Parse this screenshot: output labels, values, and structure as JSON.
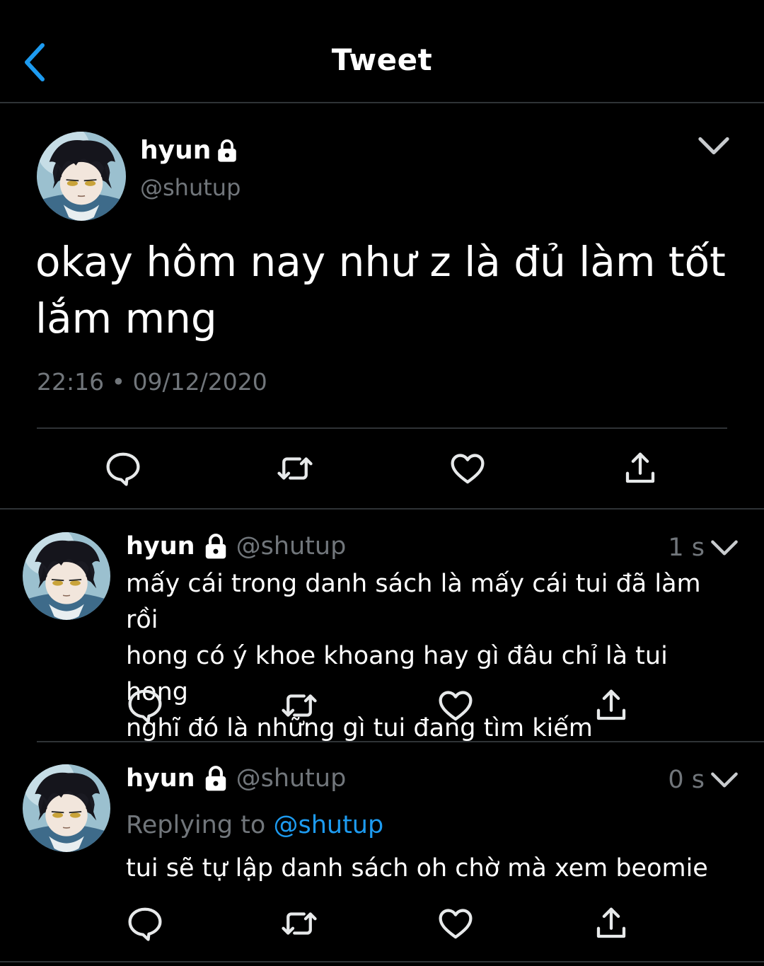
{
  "header": {
    "title": "Tweet",
    "back_icon": "chevron-left-icon",
    "accent_color": "#1d9bf0"
  },
  "main_tweet": {
    "name": "hyun",
    "handle": "@shutup",
    "locked": true,
    "text_line1": "okay hôm nay như z là đủ làm tốt",
    "text_line2": "lắm mng",
    "timestamp": "22:16 • 09/12/2020",
    "actions": [
      "reply-icon",
      "retweet-icon",
      "like-icon",
      "share-icon"
    ]
  },
  "replies": [
    {
      "name": "hyun",
      "handle": "@shutup",
      "locked": true,
      "time": "1 s",
      "text_lines": [
        "mấy cái trong danh sách là mấy cái tui đã làm rồi",
        "hong có ý khoe khoang hay gì đâu chỉ là tui hong",
        "nghĩ đó là những gì tui đang tìm kiếm"
      ]
    },
    {
      "name": "hyun",
      "handle": "@shutup",
      "locked": true,
      "time": "0 s",
      "replying_label": "Replying to",
      "replying_to": "@shutup",
      "text_lines": [
        "tui sẽ tự lập danh sách oh chờ mà xem beomie"
      ]
    }
  ]
}
